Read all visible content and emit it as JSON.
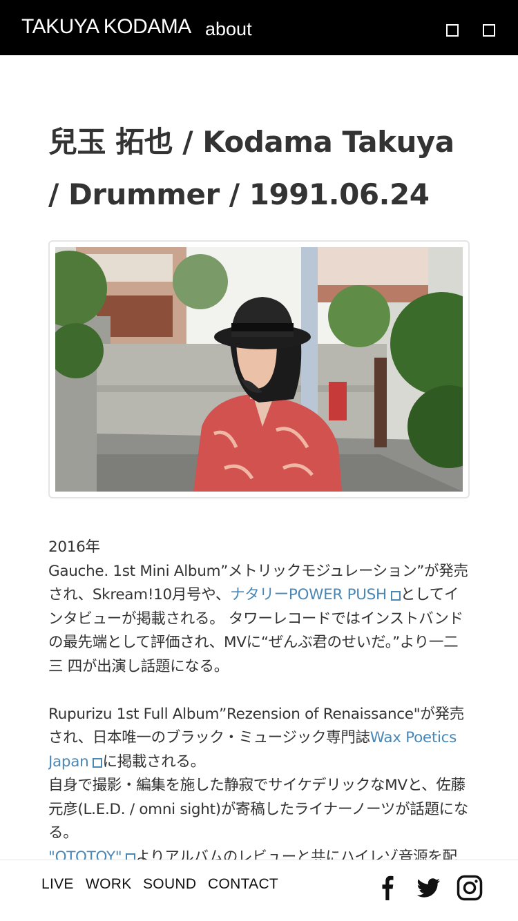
{
  "header": {
    "site_title": "TAKUYA KODAMA",
    "about_label": "about",
    "icons": [
      "square-icon",
      "square-icon"
    ]
  },
  "profile": {
    "title": "兒玉 拓也 / Kodama Takuya / Drummer / 1991.06.24"
  },
  "bio": {
    "year": "2016年",
    "p1_a": "Gauche. 1st Mini Album”メトリックモジュレーション”が発売され、Skream!10月号や、",
    "p1_link": "ナタリーPOWER PUSH",
    "p1_b": "としてインタビューが掲載される。 タワーレコードではインストバンドの最先端として評価され、MVに“ぜんぶ君のせいだ。”より一二三 四が出演し話題になる。",
    "p2_a": "Rupurizu 1st Full Album”Rezension of Renaissance\"が発売され、日本唯一のブラック・ミュージック専門誌",
    "p2_link": "Wax Poetics Japan",
    "p2_b": "に掲載される。",
    "p3": "自身で撮影・編集を施した静寂でサイケデリックなMVと、佐藤元彦(L.E.D. / omni sight)が寄稿したライナーノーツが話題になる。",
    "p4_link": "\"OTOTOY\"",
    "p4_b": "よりアルバムのレビューと共にハイレゾ音源を配信中。"
  },
  "footer": {
    "nav": [
      "LIVE",
      "WORK",
      "SOUND",
      "CONTACT"
    ],
    "social": [
      "facebook-icon",
      "twitter-icon",
      "instagram-icon"
    ]
  },
  "colors": {
    "header_bg": "#000000",
    "link": "#4a87b5",
    "text": "#333333"
  }
}
